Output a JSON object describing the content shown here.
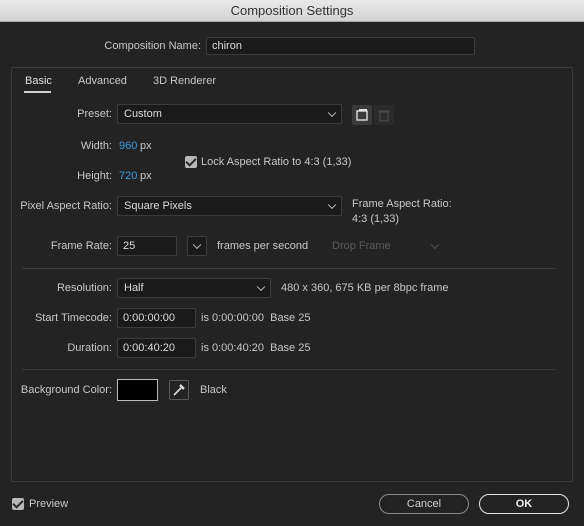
{
  "window": {
    "title": "Composition Settings"
  },
  "comp_name": {
    "label": "Composition Name:",
    "value": "chiron"
  },
  "tabs": [
    {
      "label": "Basic",
      "active": true
    },
    {
      "label": "Advanced",
      "active": false
    },
    {
      "label": "3D Renderer",
      "active": false
    }
  ],
  "preset": {
    "label": "Preset:",
    "value": "Custom"
  },
  "width": {
    "label": "Width:",
    "value": "960",
    "unit": "px"
  },
  "height": {
    "label": "Height:",
    "value": "720",
    "unit": "px"
  },
  "lock_aspect": {
    "label": "Lock Aspect Ratio to 4:3 (1,33)",
    "checked": true
  },
  "pixel_aspect": {
    "label": "Pixel Aspect Ratio:",
    "value": "Square Pixels",
    "frame_aspect_label": "Frame Aspect Ratio:",
    "frame_aspect_value": "4:3 (1,33)"
  },
  "frame_rate": {
    "label": "Frame Rate:",
    "value": "25",
    "unit": "frames per second",
    "drop_frame": "Drop Frame"
  },
  "resolution": {
    "label": "Resolution:",
    "value": "Half",
    "info": "480 x 360, 675 KB per 8bpc frame"
  },
  "start_timecode": {
    "label": "Start Timecode:",
    "value": "0:00:00:00",
    "info": "is 0:00:00:00  Base 25"
  },
  "duration": {
    "label": "Duration:",
    "value": "0:00:40:20",
    "info": "is 0:00:40:20  Base 25"
  },
  "background": {
    "label": "Background Color:",
    "color": "#000000",
    "name": "Black"
  },
  "preview": {
    "label": "Preview",
    "checked": true
  },
  "buttons": {
    "cancel": "Cancel",
    "ok": "OK"
  },
  "colors": {
    "accent": "#3b9de0",
    "background": "#232323",
    "field": "#1a1a1a"
  }
}
